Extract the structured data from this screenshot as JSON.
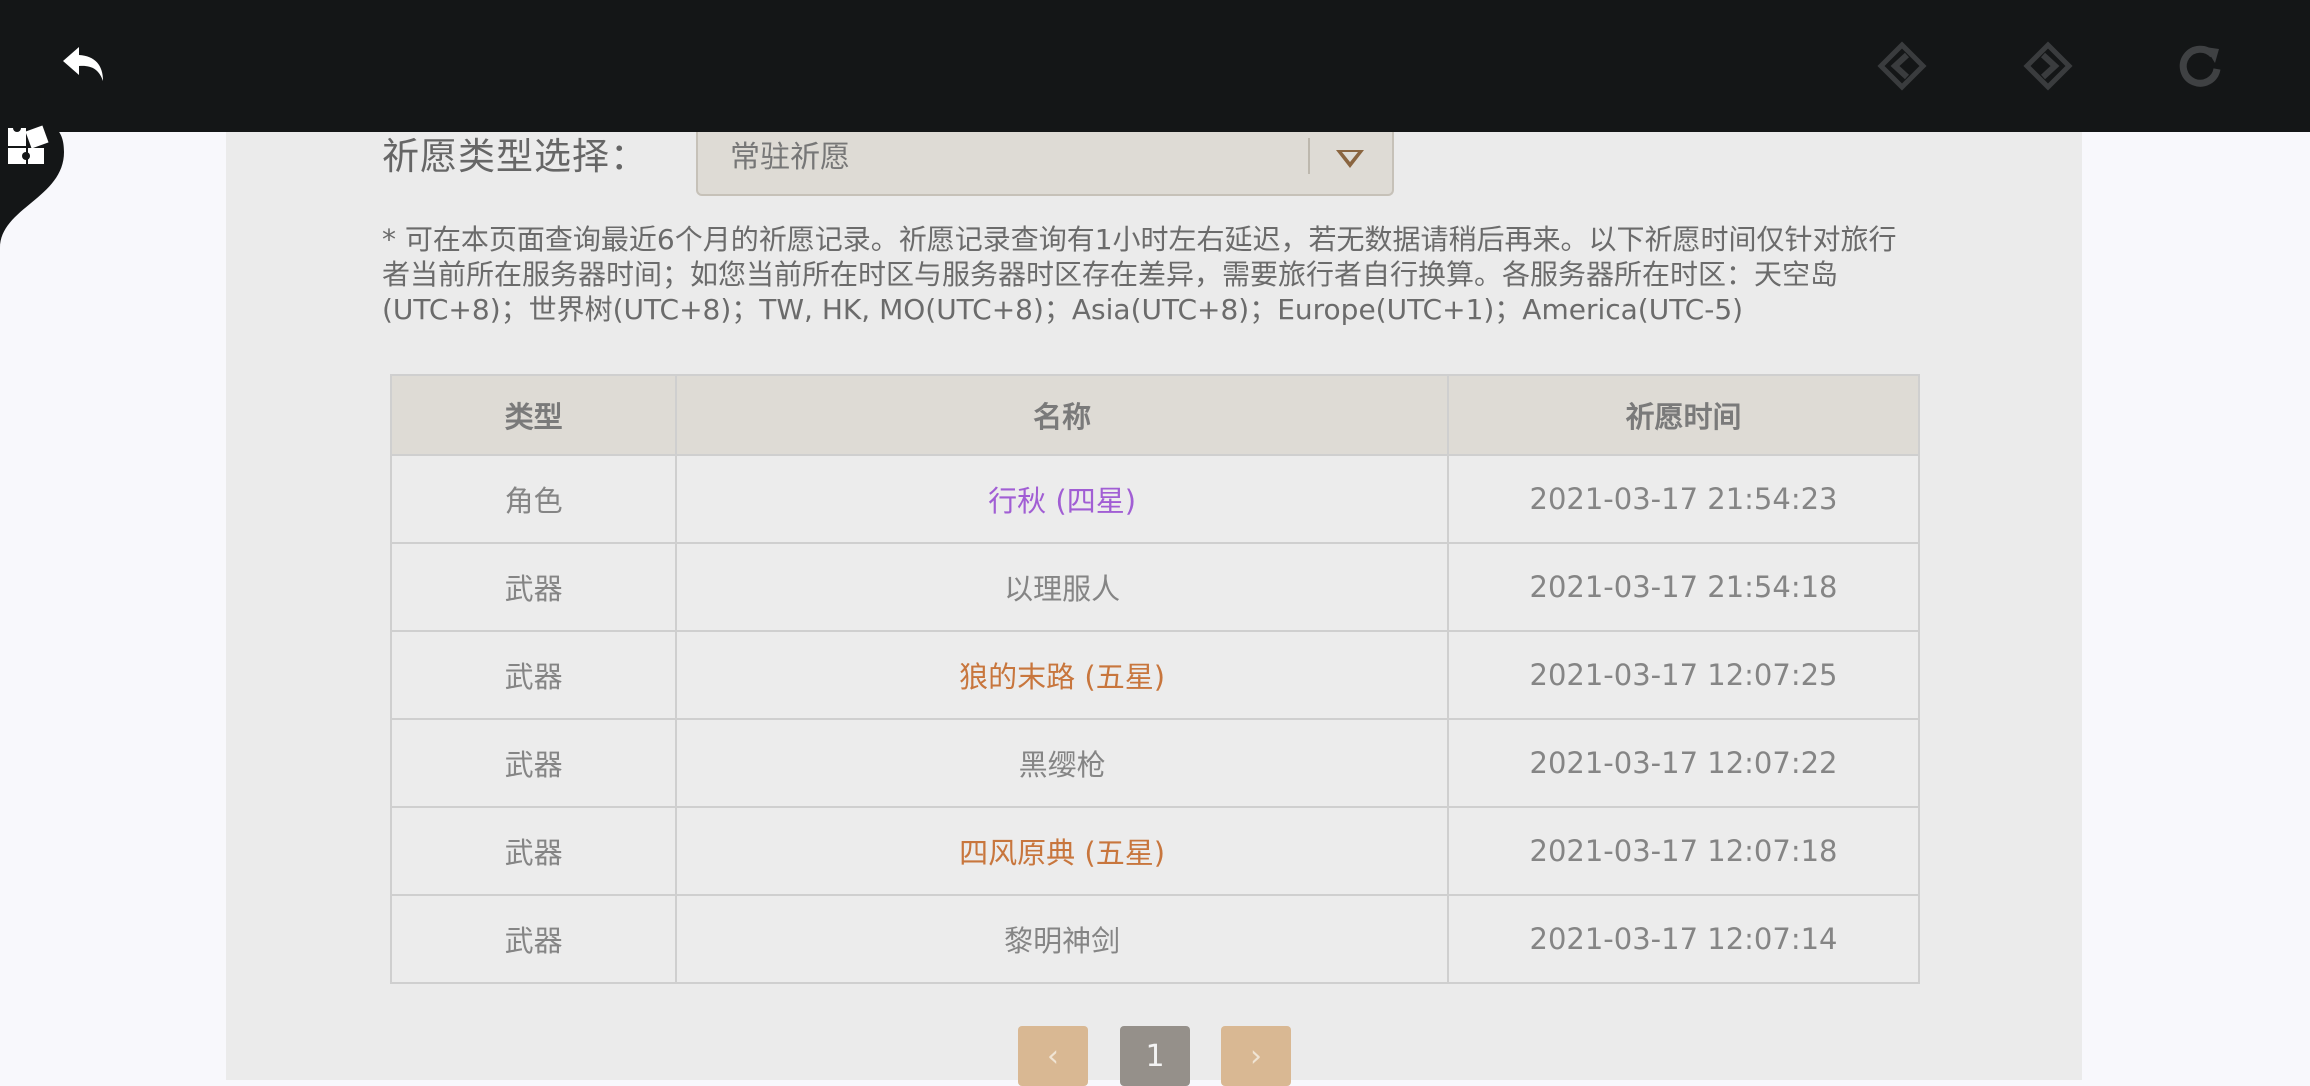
{
  "toolbar": {
    "back_icon": "undo-arrow-icon",
    "prev_icon": "diamond-left-icon",
    "next_icon": "diamond-right-icon",
    "reload_icon": "refresh-icon"
  },
  "side_tab": {
    "icon": "puzzle-icon"
  },
  "filter": {
    "label": "祈愿类型选择：",
    "selected": "常驻祈愿"
  },
  "notice": "* 可在本页面查询最近6个月的祈愿记录。祈愿记录查询有1小时左右延迟，若无数据请稍后再来。以下祈愿时间仅针对旅行者当前所在服务器时间；如您当前所在时区与服务器时区存在差异，需要旅行者自行换算。各服务器所在时区：天空岛(UTC+8)；世界树(UTC+8)；TW, HK, MO(UTC+8)；Asia(UTC+8)；Europe(UTC+1)；America(UTC-5)",
  "table": {
    "headers": [
      "类型",
      "名称",
      "祈愿时间"
    ],
    "rows": [
      {
        "type": "角色",
        "name": "行秋 (四星)",
        "time": "2021-03-17 21:54:23",
        "rarity": "four"
      },
      {
        "type": "武器",
        "name": "以理服人",
        "time": "2021-03-17 21:54:18",
        "rarity": "three"
      },
      {
        "type": "武器",
        "name": "狼的末路 (五星)",
        "time": "2021-03-17 12:07:25",
        "rarity": "five"
      },
      {
        "type": "武器",
        "name": "黑缨枪",
        "time": "2021-03-17 12:07:22",
        "rarity": "three"
      },
      {
        "type": "武器",
        "name": "四风原典 (五星)",
        "time": "2021-03-17 12:07:18",
        "rarity": "five"
      },
      {
        "type": "武器",
        "name": "黎明神剑",
        "time": "2021-03-17 12:07:14",
        "rarity": "three"
      }
    ]
  },
  "pager": {
    "prev": "‹",
    "current": "1",
    "next": "›"
  },
  "colors": {
    "four_star": "#a15ed4",
    "five_star": "#c8763d",
    "toolbar_bg": "#141617"
  }
}
